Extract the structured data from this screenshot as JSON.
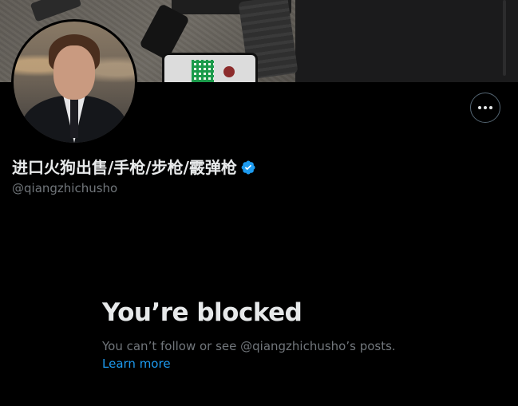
{
  "profile": {
    "display_name": "进口火狗出售/手枪/步枪/霰弹枪",
    "handle": "@qiangzhichusho",
    "verified": true
  },
  "actions": {
    "more_icon": "more-horizontal-icon"
  },
  "blocked": {
    "title": "You’re blocked",
    "message": "You can’t follow or see @qiangzhichusho’s posts.",
    "learn_more": "Learn more"
  },
  "colors": {
    "background": "#000000",
    "primary_text": "#e7e9ea",
    "secondary_text": "#71767b",
    "link": "#1d9bf0",
    "verified_badge": "#1d9bf0",
    "button_border": "#536471"
  }
}
